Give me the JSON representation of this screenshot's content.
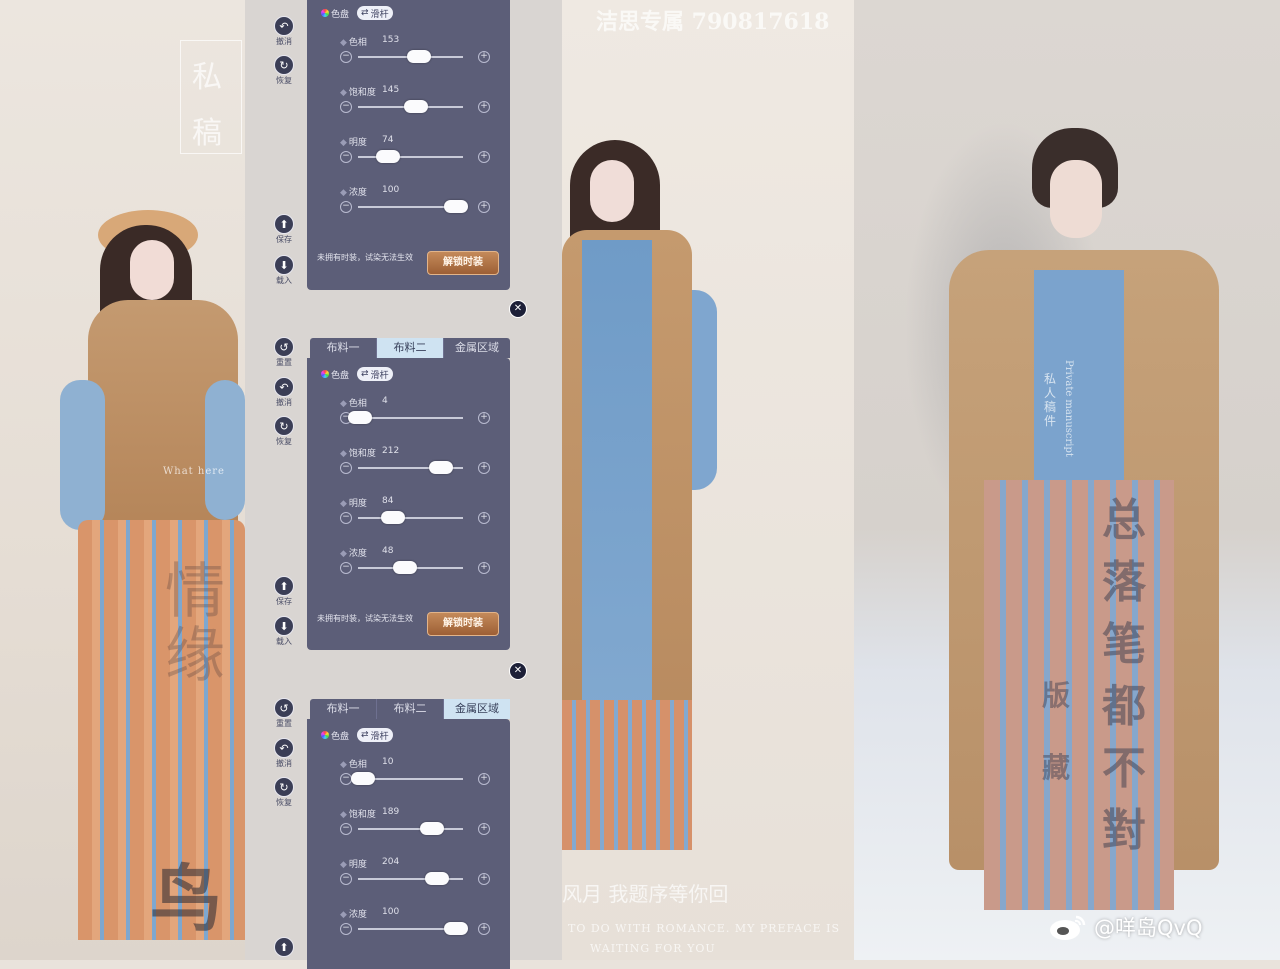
{
  "watermarks": {
    "top_center": "洁思专属  790817618",
    "left_seal": [
      "私",
      "稿"
    ],
    "left_vertical": "情缘",
    "left_brush": "鸟",
    "mid_caption": "风月 我题序等你回",
    "mid_caption_en_1": "TO DO WITH ROMANCE. MY PREFACE IS",
    "mid_caption_en_2": "WAITING FOR YOU",
    "right_vertical_1": "总落笔都不對",
    "right_vertical_2": "版 藏",
    "right_small": "私人稿件",
    "right_en": "Private manuscript",
    "left_en": "What here"
  },
  "weibo": {
    "handle": "@咩岛QvQ"
  },
  "side_buttons": {
    "reset": "重置",
    "undo": "撤消",
    "restore": "恢复",
    "save": "保存",
    "load": "载入"
  },
  "tabs": [
    "布料一",
    "布料二",
    "金属区域"
  ],
  "modes": {
    "palette": "色盘",
    "slider": "滑杆"
  },
  "notice": "未拥有时装，试染无法生效",
  "unlock_label": "解锁时装",
  "icons": {
    "reset": "↺",
    "undo": "↶",
    "restore": "↻",
    "save": "⬆",
    "load": "⬇",
    "close": "✕",
    "minus": "−",
    "plus": "+"
  },
  "panels": [
    {
      "active_tab": "",
      "sliders": [
        {
          "label": "色相",
          "value": "153",
          "fraction": 0.58
        },
        {
          "label": "饱和度",
          "value": "145",
          "fraction": 0.55
        },
        {
          "label": "明度",
          "value": "74",
          "fraction": 0.29
        },
        {
          "label": "浓度",
          "value": "100",
          "fraction": 0.93
        }
      ]
    },
    {
      "active_tab": "布料二",
      "sliders": [
        {
          "label": "色相",
          "value": "4",
          "fraction": 0.02
        },
        {
          "label": "饱和度",
          "value": "212",
          "fraction": 0.79
        },
        {
          "label": "明度",
          "value": "84",
          "fraction": 0.33
        },
        {
          "label": "浓度",
          "value": "48",
          "fraction": 0.45
        }
      ]
    },
    {
      "active_tab": "金属区域",
      "sliders": [
        {
          "label": "色相",
          "value": "10",
          "fraction": 0.05
        },
        {
          "label": "饱和度",
          "value": "189",
          "fraction": 0.7
        },
        {
          "label": "明度",
          "value": "204",
          "fraction": 0.75
        },
        {
          "label": "浓度",
          "value": "100",
          "fraction": 0.93
        }
      ]
    }
  ]
}
